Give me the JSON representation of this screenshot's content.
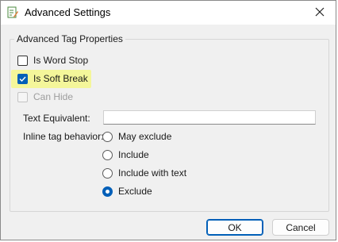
{
  "window": {
    "title": "Advanced Settings",
    "icons": {
      "app": "edit-document-icon",
      "close": "close-icon"
    }
  },
  "group": {
    "title": "Advanced Tag Properties"
  },
  "checkboxes": [
    {
      "label": "Is Word Stop",
      "checked": false,
      "disabled": false
    },
    {
      "label": "Is Soft Break",
      "checked": true,
      "disabled": false,
      "highlighted": true
    },
    {
      "label": "Can Hide",
      "checked": false,
      "disabled": true
    }
  ],
  "text_equivalent": {
    "label": "Text Equivalent:",
    "value": ""
  },
  "inline_behavior": {
    "label": "Inline tag behavior:",
    "options": [
      {
        "label": "May exclude",
        "selected": false
      },
      {
        "label": "Include",
        "selected": false
      },
      {
        "label": "Include with text",
        "selected": false
      },
      {
        "label": "Exclude",
        "selected": true
      }
    ]
  },
  "buttons": {
    "ok": "OK",
    "cancel": "Cancel"
  },
  "colors": {
    "accent": "#005fb8",
    "highlight": "#f4f69a"
  }
}
